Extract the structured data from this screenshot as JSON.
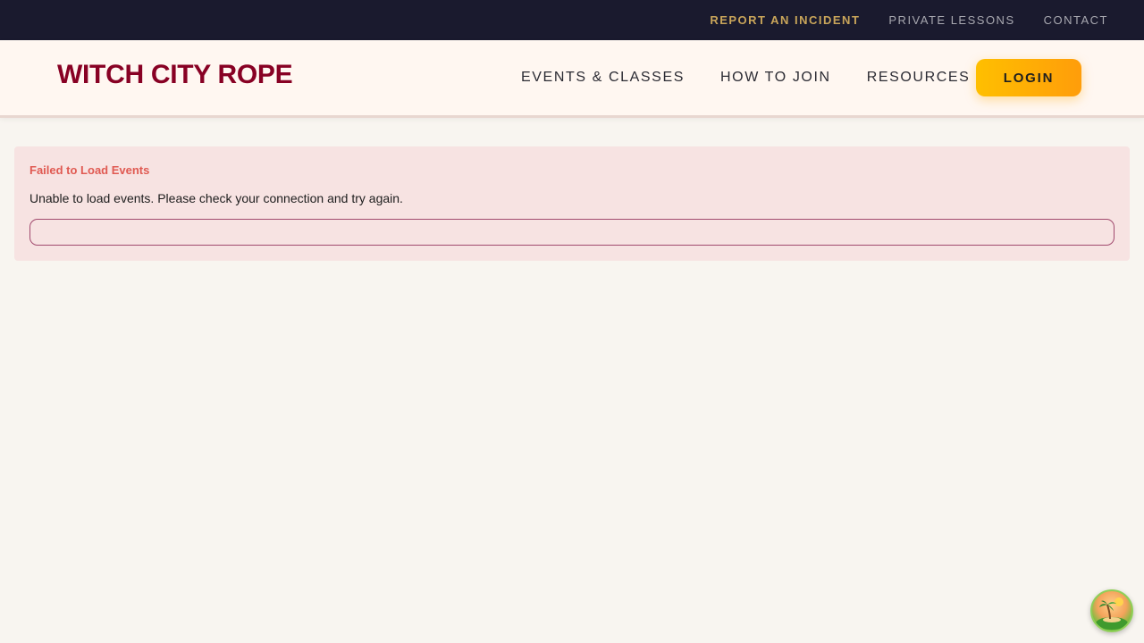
{
  "utility_nav": {
    "report_incident": "REPORT AN INCIDENT",
    "private_lessons": "PRIVATE LESSONS",
    "contact": "CONTACT"
  },
  "header": {
    "brand": "WITCH CITY ROPE",
    "nav": {
      "events_classes": "EVENTS & CLASSES",
      "how_to_join": "HOW TO JOIN",
      "resources": "RESOURCES"
    },
    "login_label": "LOGIN"
  },
  "error": {
    "title": "Failed to Load Events",
    "message": "Unable to load events. Please check your connection and try again.",
    "retry_label": ""
  },
  "floating_widget": {
    "icon": "island-icon"
  },
  "colors": {
    "utility_bar_bg": "#1a1a2e",
    "brand": "#880124",
    "incident_accent": "#c9a55a",
    "login_gradient_start": "#ffbf00",
    "login_gradient_end": "#ff9d0a",
    "error_bg": "#f7e3e2",
    "error_title": "#e05a52",
    "page_bg": "#f8f5f0"
  }
}
